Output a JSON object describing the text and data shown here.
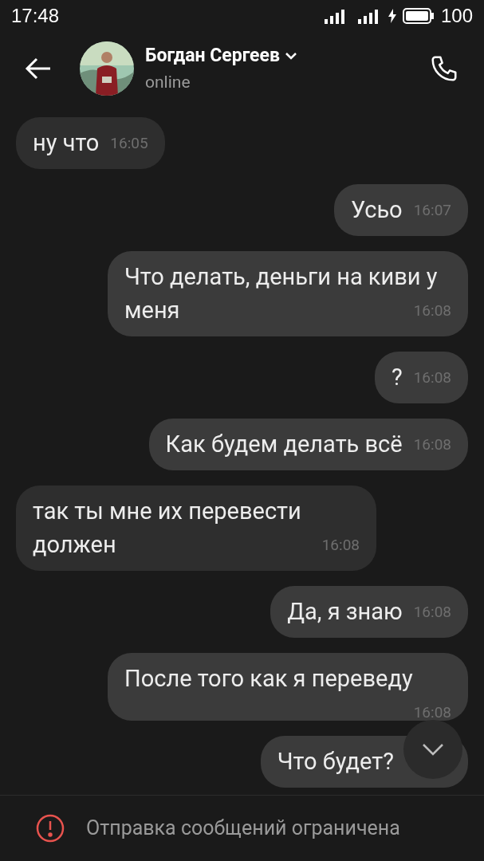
{
  "status_bar": {
    "time": "17:48",
    "battery": "100"
  },
  "header": {
    "name": "Богдан Сергеев",
    "status": "online"
  },
  "messages": [
    {
      "text": "ну что",
      "time": "16:05",
      "outgoing": false
    },
    {
      "text": "Усьо",
      "time": "16:07",
      "outgoing": true
    },
    {
      "text": "Что делать, деньги на киви у меня",
      "time": "16:08",
      "outgoing": true
    },
    {
      "text": "?",
      "time": "16:08",
      "outgoing": true
    },
    {
      "text": "Как будем делать всё",
      "time": "16:08",
      "outgoing": true
    },
    {
      "text": "так ты мне их перевести должен",
      "time": "16:08",
      "outgoing": false
    },
    {
      "text": "Да, я знаю",
      "time": "16:08",
      "outgoing": true
    },
    {
      "text": "После того как я переведу",
      "time": "16:08",
      "outgoing": true
    },
    {
      "text": "Что будет?",
      "outgoing": true
    }
  ],
  "notice": "Отправка сообщений ограничена"
}
